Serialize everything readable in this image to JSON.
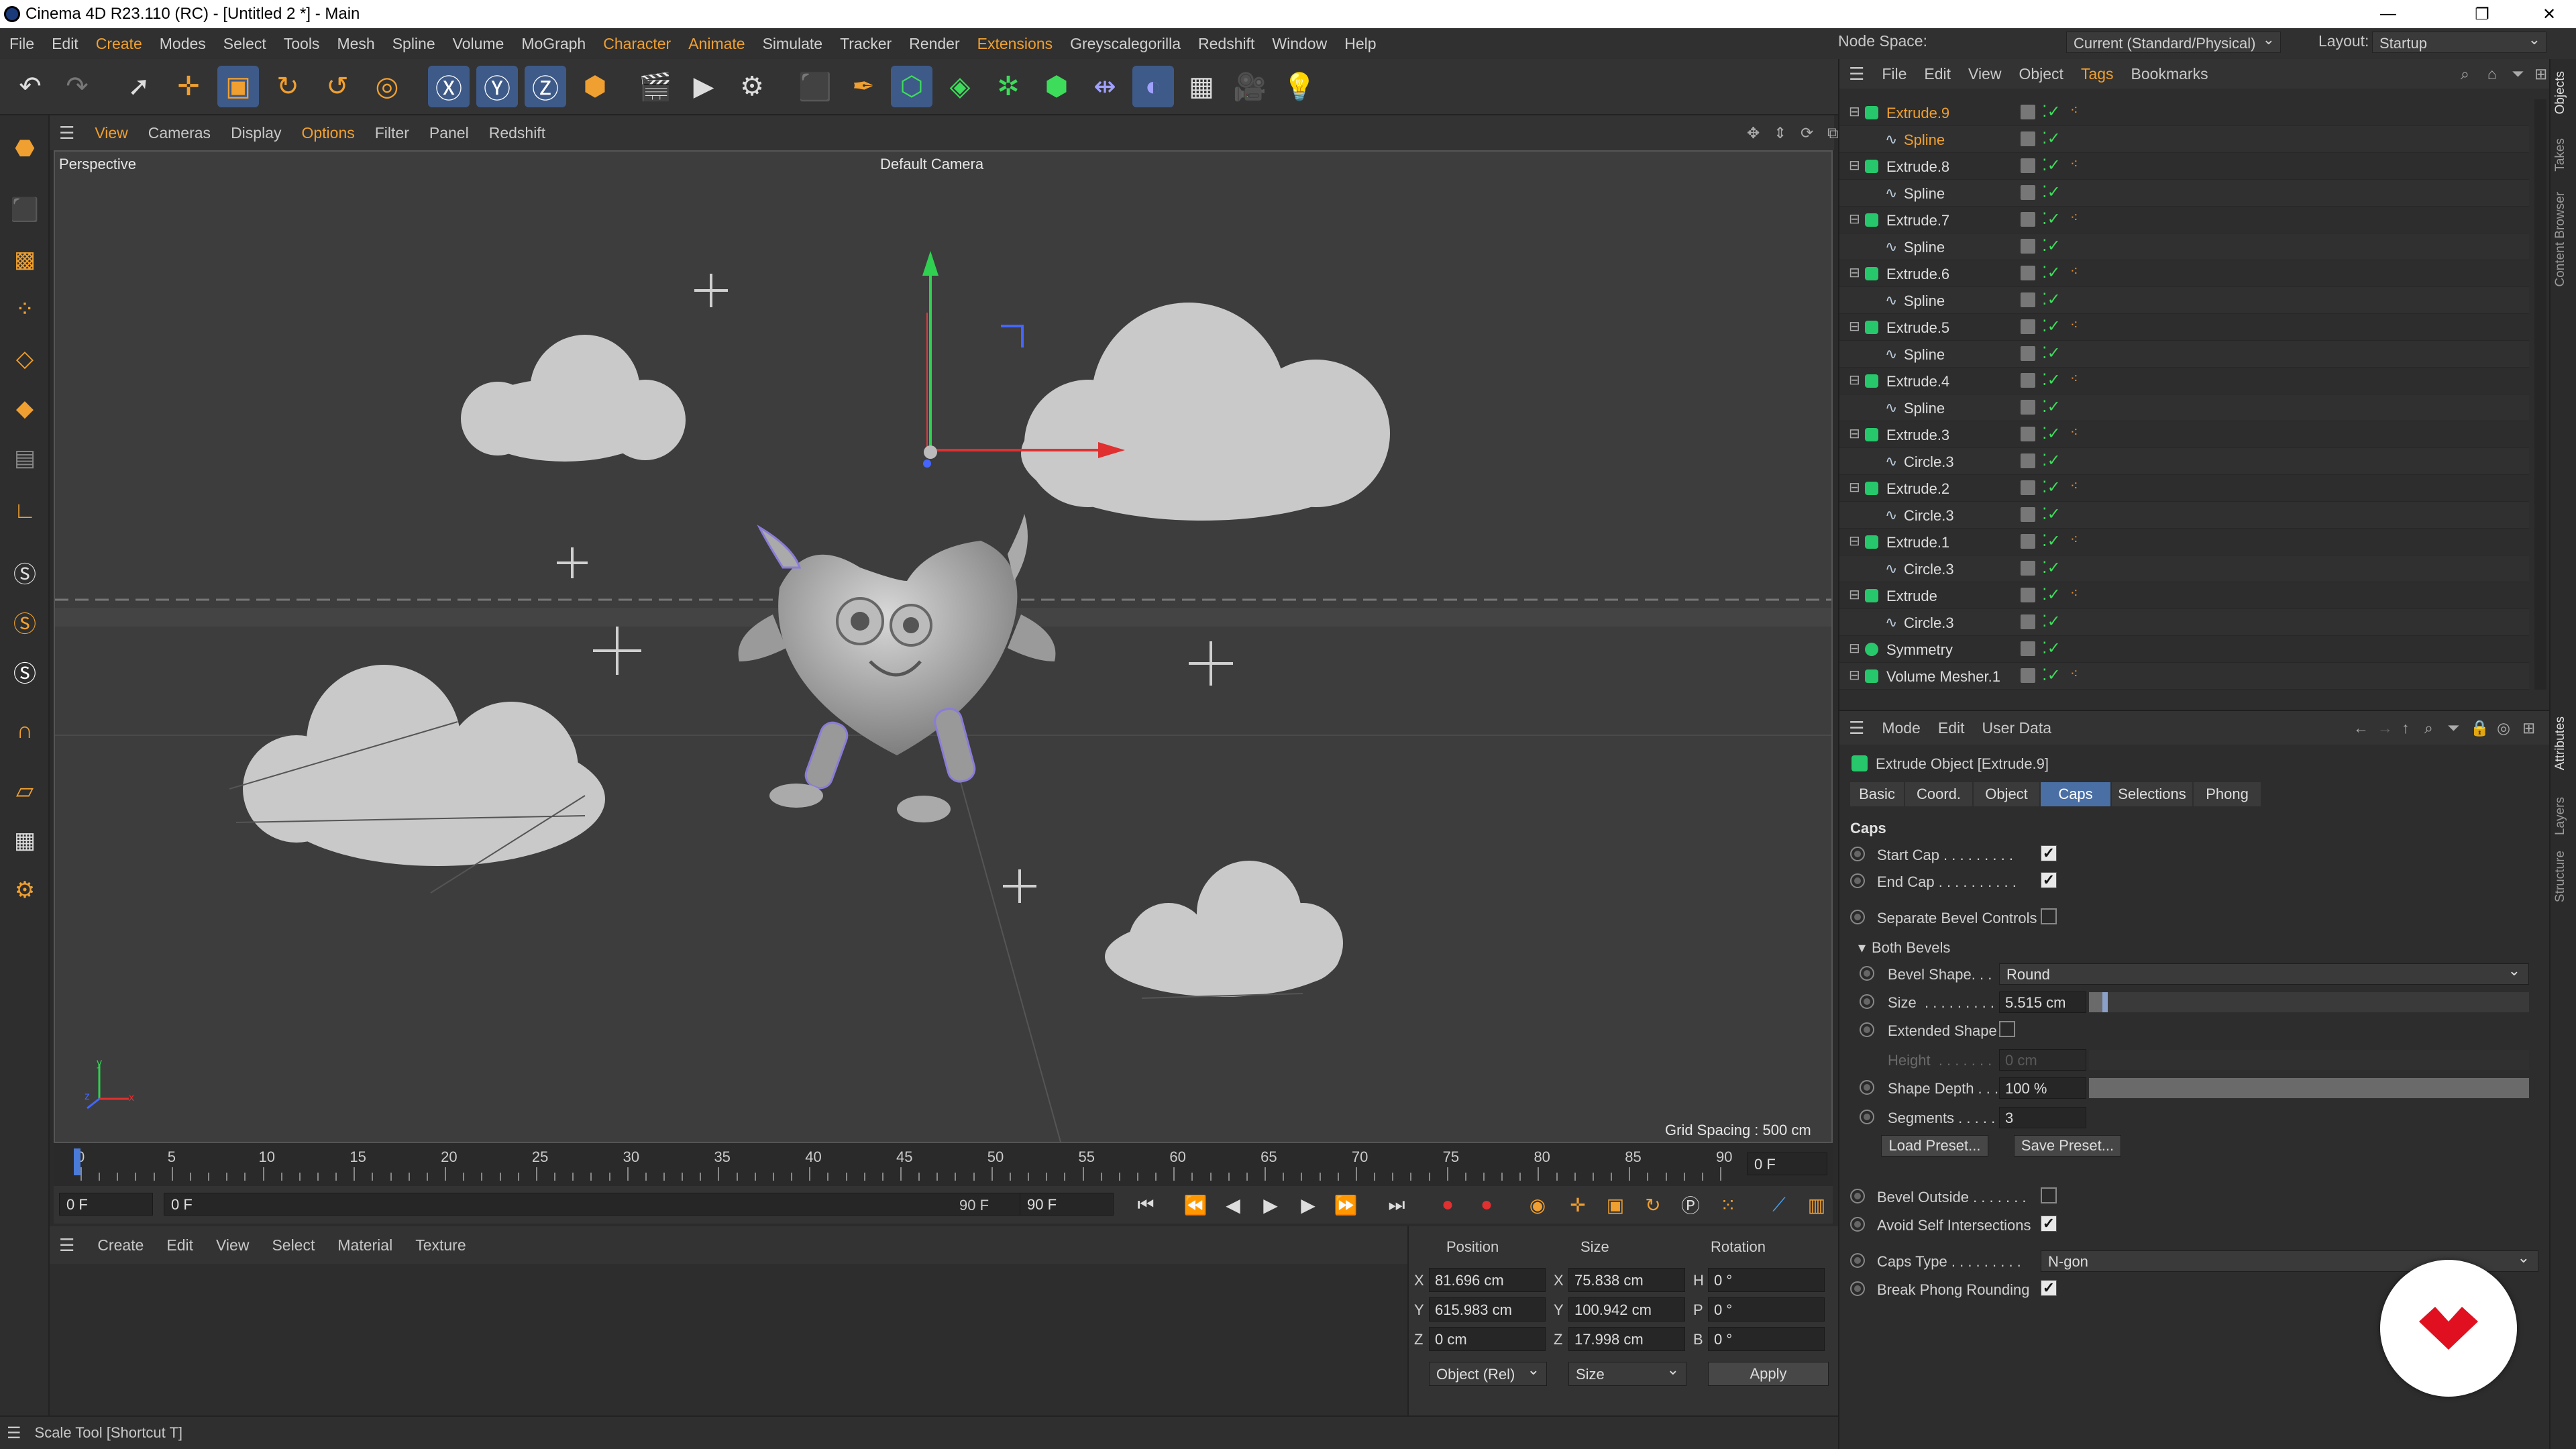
{
  "window": {
    "title": "Cinema 4D R23.110 (RC) - [Untitled 2 *] - Main"
  },
  "menu": [
    "File",
    "Edit",
    "Create",
    "Modes",
    "Select",
    "Tools",
    "Mesh",
    "Spline",
    "Volume",
    "MoGraph",
    "Character",
    "Animate",
    "Simulate",
    "Tracker",
    "Render",
    "Extensions",
    "Greyscalegorilla",
    "Redshift",
    "Window",
    "Help"
  ],
  "menu_accent": [
    "Create",
    "Character",
    "Animate",
    "Extensions"
  ],
  "node_space": {
    "label": "Node Space:",
    "value": "Current (Standard/Physical)"
  },
  "layout": {
    "label": "Layout:",
    "value": "Startup"
  },
  "viewport_menu": [
    "View",
    "Cameras",
    "Display",
    "Options",
    "Filter",
    "Panel",
    "Redshift"
  ],
  "viewport": {
    "name": "Perspective",
    "camera": "Default Camera",
    "grid_spacing": "Grid Spacing : 500 cm",
    "axis_y": "y",
    "axis_z": "z",
    "axis_x": "x"
  },
  "timeline": {
    "ticks": [
      "0",
      "5",
      "10",
      "15",
      "20",
      "25",
      "30",
      "35",
      "40",
      "45",
      "50",
      "55",
      "60",
      "65",
      "70",
      "75",
      "80",
      "85",
      "90"
    ],
    "current_frame": "0 F",
    "start": "0 F",
    "range_start": "0 F",
    "range_end": "90 F",
    "end": "90 F"
  },
  "material_menu": [
    "Create",
    "Edit",
    "View",
    "Select",
    "Material",
    "Texture"
  ],
  "coordinates": {
    "headers": {
      "position": "Position",
      "size": "Size",
      "rotation": "Rotation"
    },
    "rows": [
      {
        "axis": "X",
        "pos": "81.696 cm",
        "saxis": "X",
        "size": "75.838 cm",
        "raxis": "H",
        "rot": "0 °"
      },
      {
        "axis": "Y",
        "pos": "615.983 cm",
        "saxis": "Y",
        "size": "100.942 cm",
        "raxis": "P",
        "rot": "0 °"
      },
      {
        "axis": "Z",
        "pos": "0 cm",
        "saxis": "Z",
        "size": "17.998 cm",
        "raxis": "B",
        "rot": "0 °"
      }
    ],
    "mode": "Object (Rel)",
    "size_mode": "Size",
    "apply": "Apply"
  },
  "status": "Scale Tool [Shortcut T]",
  "object_menu": [
    "File",
    "Edit",
    "View",
    "Object",
    "Tags",
    "Bookmarks"
  ],
  "objects": [
    {
      "name": "Extrude.9",
      "child": false,
      "tag": true,
      "selected": true
    },
    {
      "name": "Spline",
      "child": true,
      "tag": false,
      "selected": true
    },
    {
      "name": "Extrude.8",
      "child": false,
      "tag": true
    },
    {
      "name": "Spline",
      "child": true,
      "tag": false
    },
    {
      "name": "Extrude.7",
      "child": false,
      "tag": true
    },
    {
      "name": "Spline",
      "child": true,
      "tag": false
    },
    {
      "name": "Extrude.6",
      "child": false,
      "tag": true
    },
    {
      "name": "Spline",
      "child": true,
      "tag": false
    },
    {
      "name": "Extrude.5",
      "child": false,
      "tag": true
    },
    {
      "name": "Spline",
      "child": true,
      "tag": false
    },
    {
      "name": "Extrude.4",
      "child": false,
      "tag": true
    },
    {
      "name": "Spline",
      "child": true,
      "tag": false
    },
    {
      "name": "Extrude.3",
      "child": false,
      "tag": true
    },
    {
      "name": "Circle.3",
      "child": true,
      "tag": false
    },
    {
      "name": "Extrude.2",
      "child": false,
      "tag": true
    },
    {
      "name": "Circle.3",
      "child": true,
      "tag": false
    },
    {
      "name": "Extrude.1",
      "child": false,
      "tag": true
    },
    {
      "name": "Circle.3",
      "child": true,
      "tag": false
    },
    {
      "name": "Extrude",
      "child": false,
      "tag": true
    },
    {
      "name": "Circle.3",
      "child": true,
      "tag": false
    },
    {
      "name": "Symmetry",
      "child": false,
      "tag": false
    },
    {
      "name": "Volume Mesher.1",
      "child": false,
      "tag": true
    }
  ],
  "attributes": {
    "menu": [
      "Mode",
      "Edit",
      "User Data"
    ],
    "object_title": "Extrude Object [Extrude.9]",
    "tabs": [
      "Basic",
      "Coord.",
      "Object",
      "Caps",
      "Selections",
      "Phong"
    ],
    "active_tab": "Caps",
    "section": "Caps",
    "start_cap": "Start Cap . . . . . . . . .",
    "end_cap": "End Cap . . . . . . . . . .",
    "separate_bevel": "Separate Bevel Controls",
    "both_bevels": "Both Bevels",
    "bevel_shape_label": "Bevel Shape. . .",
    "bevel_shape_value": "Round",
    "size_label": "Size  . . . . . . . . .",
    "size_value": "5.515 cm",
    "size_level": 0.03,
    "extended_shape": "Extended Shape",
    "height_label": "Height  . . . . . . .",
    "height_value": "0 cm",
    "shape_depth_label": "Shape Depth . . .",
    "shape_depth_value": "100 %",
    "shape_depth_level": 1.0,
    "segments_label": "Segments . . . . .",
    "segments_value": "3",
    "load_preset": "Load Preset...",
    "save_preset": "Save Preset...",
    "bevel_outside": "Bevel Outside . . . . . . .",
    "avoid_self": "Avoid Self Intersections",
    "caps_type_label": "Caps Type . . . . . . . . .",
    "caps_type_value": "N-gon",
    "break_phong": "Break Phong Rounding"
  },
  "side_tabs": [
    "Objects",
    "Takes",
    "Content Browser",
    "Attributes",
    "Layers",
    "Structure"
  ],
  "colors": {
    "accent": "#f0a030",
    "selected_tab": "#4a6fa5",
    "object_icon": "#27c76b",
    "check": "#3ddc5a",
    "axis_x": "#e03030",
    "axis_y": "#30d050"
  }
}
